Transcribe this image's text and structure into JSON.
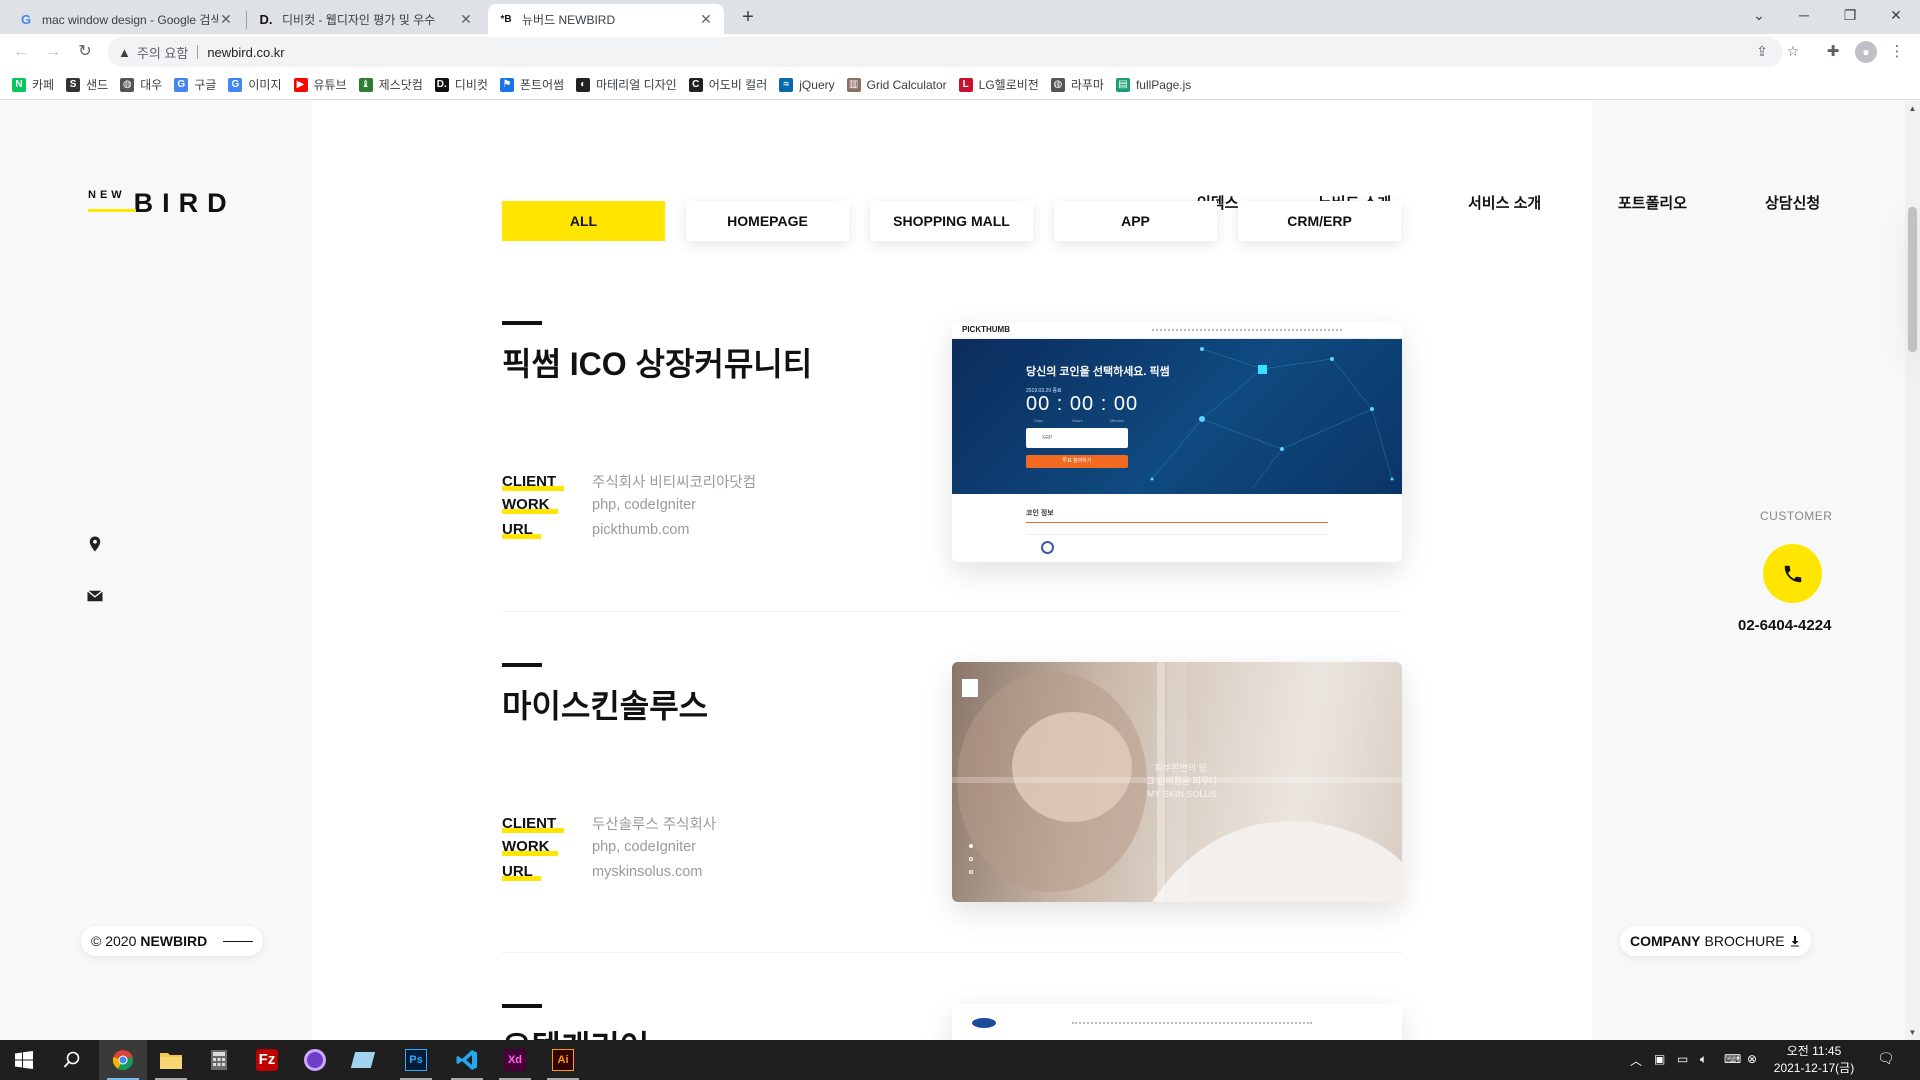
{
  "browser": {
    "tabs": [
      {
        "title": "mac window design - Google 검색",
        "favicon": "G"
      },
      {
        "title": "디비컷 - 웹디자인 평가 및 우수",
        "favicon": "D."
      },
      {
        "title": "뉴버드 NEWBIRD",
        "favicon": "*B"
      }
    ],
    "security_label": "주의 요함",
    "url": "newbird.co.kr",
    "bookmarks": [
      {
        "label": "카페",
        "color": "#03c75a",
        "glyph": "N"
      },
      {
        "label": "샌드",
        "color": "#333333",
        "glyph": "S"
      },
      {
        "label": "대우",
        "color": "#555555",
        "glyph": "◍"
      },
      {
        "label": "구글",
        "color": "#4285f4",
        "glyph": "G"
      },
      {
        "label": "이미지",
        "color": "#4285f4",
        "glyph": "G"
      },
      {
        "label": "유튜브",
        "color": "#ff0000",
        "glyph": "▶"
      },
      {
        "label": "제스닷컴",
        "color": "#2e7d32",
        "glyph": "♝"
      },
      {
        "label": "디비컷",
        "color": "#111111",
        "glyph": "D."
      },
      {
        "label": "폰트어썸",
        "color": "#1a73e8",
        "glyph": "⚑"
      },
      {
        "label": "마테리얼 디자인",
        "color": "#222222",
        "glyph": "◐"
      },
      {
        "label": "어도비 컬러",
        "color": "#222222",
        "glyph": "C"
      },
      {
        "label": "jQuery",
        "color": "#0769ad",
        "glyph": "≈"
      },
      {
        "label": "Grid Calculator",
        "color": "#8d6e63",
        "glyph": "▥"
      },
      {
        "label": "LG헬로비전",
        "color": "#c8102e",
        "glyph": "L"
      },
      {
        "label": "라푸마",
        "color": "#555555",
        "glyph": "◍"
      },
      {
        "label": "fullPage.js",
        "color": "#1d9e74",
        "glyph": "▤"
      }
    ]
  },
  "site": {
    "logo_new": "NEW",
    "logo_bird": "BIRD",
    "nav": [
      "인덱스",
      "뉴버드 소개",
      "서비스 소개",
      "포트폴리오",
      "상담신청"
    ],
    "filters": [
      "ALL",
      "HOMEPAGE",
      "SHOPPING MALL",
      "APP",
      "CRM/ERP"
    ],
    "meta_labels": {
      "client": "CLIENT",
      "work": "WORK",
      "url": "URL"
    },
    "projects": [
      {
        "title": "픽썸 ICO 상장커뮤니티",
        "client": "주식회사 비티씨코리아닷컴",
        "work": "php, codeIgniter",
        "url": "pickthumb.com"
      },
      {
        "title": "마이스킨솔루스",
        "client": "두산솔루스 주식회사",
        "work": "php, codeIgniter",
        "url": "myskinsolus.com"
      },
      {
        "title": "오텍캐리어"
      }
    ],
    "pickthumb_shot": {
      "brand": "PICKTHUMB",
      "headline": "당신의 코인을 선택하세요. 픽썸",
      "date": "2019.03.29 종료",
      "timer": "00 : 00 : 00",
      "timer_units": [
        "Days",
        "Hours",
        "Minutes"
      ],
      "input_text": "XRP",
      "button": "투표 참여하기",
      "section": "코인 정보"
    },
    "skin_shot": {
      "line1": "피부본연의 힘,",
      "line2": "그 신비함을 피우다",
      "line3": "MY SKIN SOLUS"
    },
    "customer_label": "CUSTOMER",
    "phone": "02-6404-4224",
    "copyright_prefix": "© 2020",
    "copyright_brand": "NEWBIRD",
    "brochure_bold": "COMPANY",
    "brochure_rest": "BROCHURE"
  },
  "taskbar": {
    "clock_time": "오전 11:45",
    "clock_date": "2021-12-17(금)"
  }
}
